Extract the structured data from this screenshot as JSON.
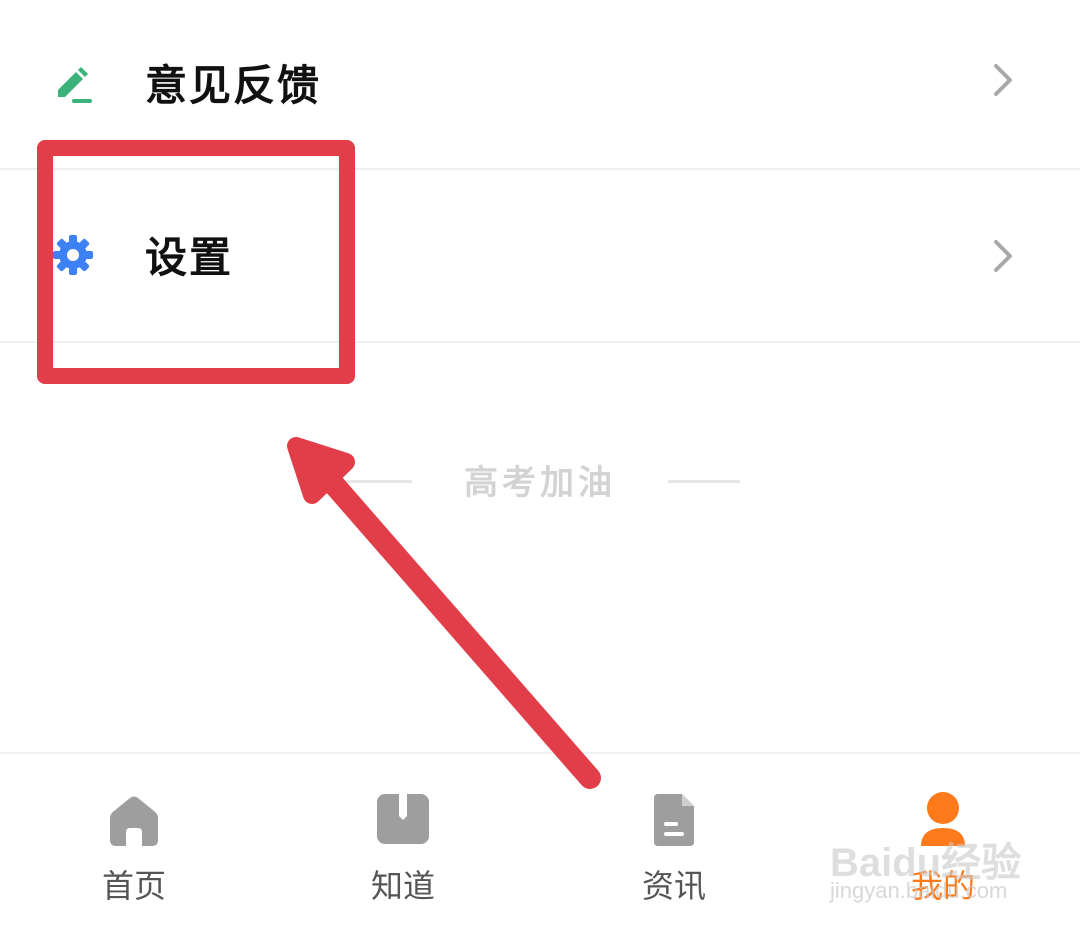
{
  "menu": {
    "feedback": {
      "label": "意见反馈",
      "icon": "pencil-icon",
      "icon_color": "#3bb27a"
    },
    "settings": {
      "label": "设置",
      "icon": "gear-icon",
      "icon_color": "#3d82f5"
    }
  },
  "slogan": "高考加油",
  "annotation": {
    "box_color": "#e23e4a",
    "arrow_color": "#e23e4a"
  },
  "tabs": [
    {
      "label": "首页",
      "icon": "home-icon",
      "active": false
    },
    {
      "label": "知道",
      "icon": "book-icon",
      "active": false
    },
    {
      "label": "资讯",
      "icon": "document-icon",
      "active": false
    },
    {
      "label": "我的",
      "icon": "user-icon",
      "active": true
    }
  ],
  "colors": {
    "active_tab": "#ff7a1a",
    "inactive_icon": "#9e9e9e"
  },
  "watermark": {
    "brand": "Baidu经验",
    "url": "jingyan.baidu.com"
  }
}
